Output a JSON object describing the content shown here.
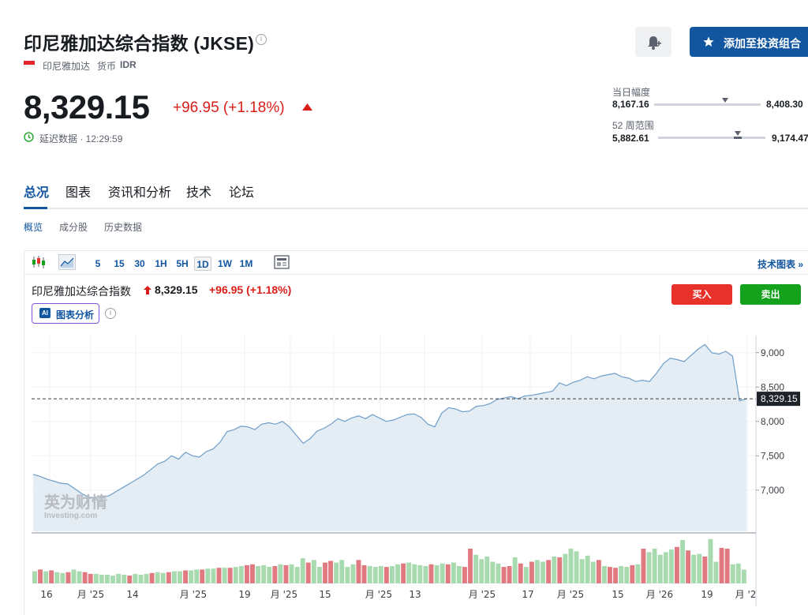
{
  "header": {
    "title": "印尼雅加达综合指数 (JKSE)",
    "exchange": "印尼雅加达",
    "currency_label": "货币",
    "currency": "IDR",
    "add_portfolio": "添加至投资组合"
  },
  "quote": {
    "price": "8,329.15",
    "change": "+96.95 (+1.18%)",
    "delay_text": "延迟数据 · 12:29:59"
  },
  "ranges": {
    "day_label": "当日幅度",
    "day_low": "8,167.16",
    "day_high": "8,408.30",
    "day_position": 0.67,
    "week52_label": "52 周范围",
    "week52_low": "5,882.61",
    "week52_high": "9,174.47",
    "week52_position": 0.74
  },
  "tabs": [
    "总况",
    "图表",
    "资讯和分析",
    "技术",
    "论坛"
  ],
  "subtabs": [
    "概览",
    "成分股",
    "历史数据"
  ],
  "chart_toolbar": {
    "timeframes": [
      "5",
      "15",
      "30",
      "1H",
      "5H",
      "1D",
      "1W",
      "1M"
    ],
    "active_timeframe": "1D",
    "tech_chart_link": "技术图表 »"
  },
  "chart_header": {
    "name": "印尼雅加达综合指数",
    "price": "8,329.15",
    "change": "+96.95 (+1.18%)",
    "buy": "买入",
    "sell": "卖出",
    "ai_label": "图表分析",
    "ai_badge": "AI"
  },
  "watermark": {
    "cn": "英为财情",
    "en": "Investing.com"
  },
  "colors": {
    "brand_blue": "#1256a0",
    "down_red": "#d91e18",
    "buy_red": "#e8312a",
    "sell_green": "#14a21c",
    "line": "#6f9ec9",
    "area": "#e4ecf4",
    "vol_up": "#a8dab0",
    "vol_down": "#e07a80"
  },
  "chart_data": {
    "type": "area",
    "ylim": [
      6400,
      9250
    ],
    "yticks": [
      7000,
      7500,
      8000,
      8500,
      9000
    ],
    "ytick_labels": [
      "7,000",
      "7,500",
      "8,000",
      "8,500",
      "9,000"
    ],
    "last_value": 8329.15,
    "last_label": "8,329.15",
    "xlabels": [
      "16",
      "月 '25",
      "14",
      "月 '25",
      "19",
      "月 '25",
      "15",
      "月 '25",
      "13",
      "月 '25",
      "17",
      "月 '25",
      "15",
      "月 '26",
      "19",
      "月 '2"
    ],
    "values": [
      7230,
      7200,
      7160,
      7130,
      7100,
      7090,
      7020,
      6950,
      6900,
      6880,
      6900,
      6920,
      6980,
      7040,
      7100,
      7160,
      7220,
      7300,
      7380,
      7420,
      7500,
      7450,
      7550,
      7500,
      7480,
      7560,
      7600,
      7700,
      7850,
      7880,
      7930,
      7920,
      7880,
      7960,
      7980,
      7960,
      8000,
      7920,
      7800,
      7680,
      7750,
      7860,
      7900,
      7960,
      8040,
      8000,
      8050,
      8080,
      8040,
      8100,
      8050,
      8000,
      8020,
      8060,
      8100,
      8110,
      8060,
      7960,
      7920,
      8120,
      8200,
      8180,
      8140,
      8150,
      8220,
      8230,
      8260,
      8320,
      8340,
      8360,
      8330,
      8370,
      8380,
      8400,
      8420,
      8440,
      8560,
      8520,
      8570,
      8600,
      8650,
      8620,
      8660,
      8680,
      8700,
      8650,
      8630,
      8580,
      8600,
      8580,
      8700,
      8840,
      8920,
      8900,
      8870,
      8960,
      9050,
      9120,
      9000,
      8980,
      9020,
      8950,
      8300,
      8329
    ],
    "volume_signs": [
      1,
      -1,
      1,
      -1,
      1,
      1,
      -1,
      1,
      1,
      -1,
      -1,
      1,
      1,
      1,
      1,
      1,
      1,
      -1,
      1,
      1,
      1,
      -1,
      1,
      1,
      -1,
      1,
      1,
      -1,
      1,
      1,
      -1,
      1,
      1,
      -1,
      1,
      -1,
      1,
      1,
      -1,
      -1,
      1,
      1,
      1,
      -1,
      1,
      -1,
      1,
      1,
      1,
      -1,
      1,
      1,
      -1,
      -1,
      1,
      1,
      1,
      1,
      -1,
      -1,
      1,
      1,
      1,
      -1,
      1,
      1,
      -1,
      1,
      1,
      1,
      1,
      -1,
      1,
      1,
      -1,
      1,
      1,
      -1,
      -1,
      1,
      1,
      1,
      1,
      1,
      -1,
      -1,
      1,
      -1,
      1,
      -1,
      1,
      1,
      -1,
      1,
      -1,
      1,
      1,
      1,
      1,
      1,
      1,
      -1,
      1,
      -1,
      -1,
      1,
      1,
      -1,
      1,
      -1,
      1,
      1,
      1,
      1
    ],
    "volumes": [
      14,
      16,
      14,
      15,
      13,
      12,
      13,
      16,
      14,
      13,
      11,
      11,
      10,
      10,
      9,
      11,
      10,
      9,
      11,
      10,
      11,
      12,
      13,
      12,
      13,
      14,
      14,
      15,
      15,
      16,
      16,
      17,
      17,
      18,
      18,
      18,
      19,
      20,
      21,
      22,
      20,
      21,
      19,
      20,
      22,
      21,
      22,
      19,
      29,
      24,
      27,
      19,
      24,
      26,
      24,
      27,
      19,
      22,
      27,
      21,
      20,
      19,
      20,
      19,
      20,
      22,
      23,
      24,
      22,
      21,
      20,
      22,
      21,
      23,
      22,
      24,
      20,
      19,
      40,
      33,
      28,
      31,
      25,
      23,
      19,
      20,
      30,
      23,
      19,
      25,
      27,
      25,
      27,
      31,
      30,
      34,
      40,
      37,
      28,
      32,
      25,
      27,
      20,
      19,
      18,
      20,
      19,
      21,
      22,
      40,
      36,
      40,
      33,
      36,
      39,
      42,
      50,
      38,
      33,
      34,
      31,
      51,
      25,
      41,
      40,
      22,
      23,
      16
    ]
  }
}
